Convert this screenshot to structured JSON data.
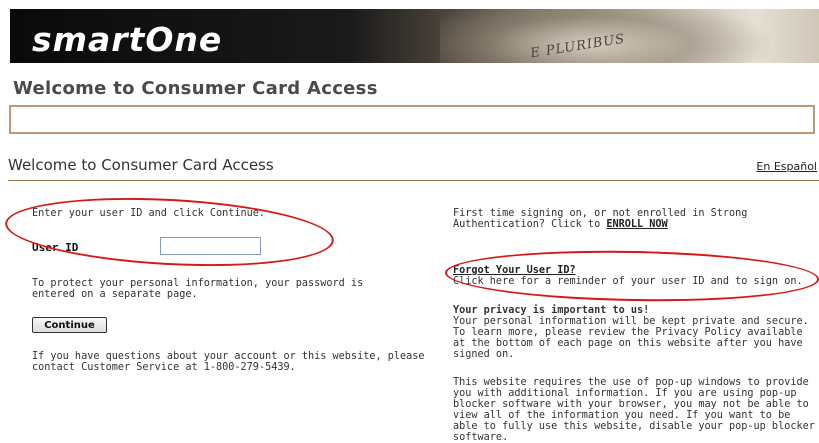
{
  "header": {
    "logo_text": "smartOne",
    "motto_text": "E PLURIBUS",
    "page_title": "Welcome to Consumer Card Access"
  },
  "section": {
    "title": "Welcome to Consumer Card Access",
    "language_link": "En Español"
  },
  "login": {
    "prompt": "Enter your user ID and click Continue.",
    "user_id_label": "User ID",
    "user_id_value": "",
    "password_note": "To protect your personal information, your password is entered on a separate page.",
    "continue_label": "Continue",
    "help_text": "If you have questions about your account or this website, please contact Customer Service at 1-800-279-5439."
  },
  "sidebar": {
    "enroll_text": "First time signing on, or not enrolled in Strong Authentication? Click to",
    "enroll_link": "ENROLL NOW",
    "forgot_link": "Forgot Your User ID?",
    "forgot_text": "Click here for a reminder of your user ID and to sign on.",
    "privacy_heading": "Your privacy is important to us!",
    "privacy_text": "Your personal information will be kept private and secure. To learn more, please review the Privacy Policy available at the bottom of each page on this website after you have signed on.",
    "popup_text": "This website requires the use of pop-up windows to provide you with additional information. If you are using pop-up blocker software with your browser, you may not be able to view all of the information you need. If you want to be able to fully use this website, disable your pop-up blocker software."
  },
  "colors": {
    "annotation": "#d61818",
    "rule": "#9a7a55",
    "message_box_border": "#b89a7a"
  }
}
